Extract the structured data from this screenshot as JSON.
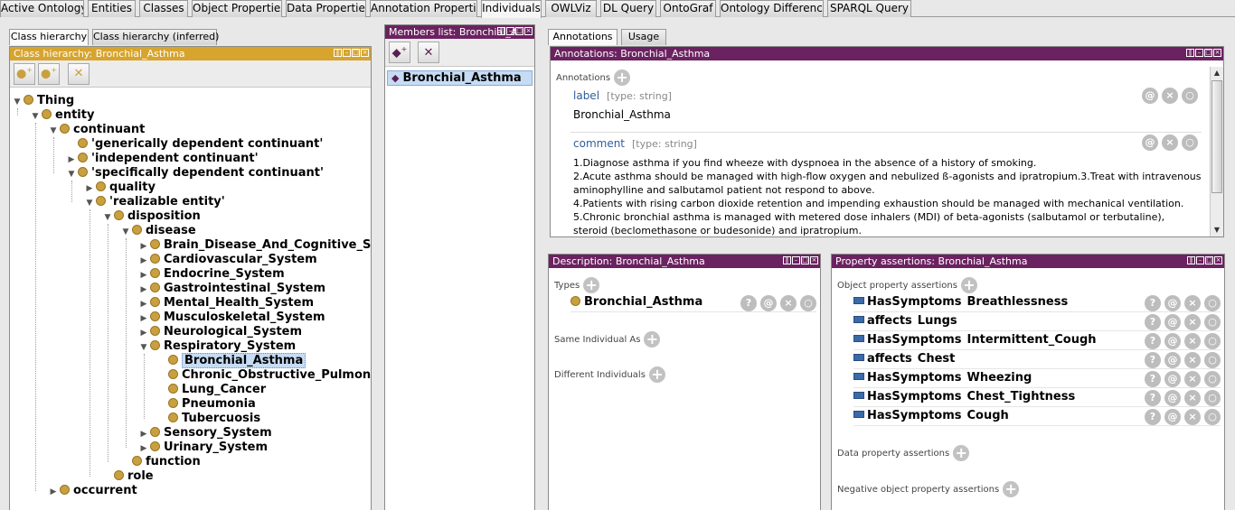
{
  "main_tabs": [
    "Active Ontology",
    "Entities",
    "Classes",
    "Object Properties",
    "Data Properties",
    "Annotation Properties",
    "Individuals",
    "OWLViz",
    "DL Query",
    "OntoGraf",
    "Ontology Differences",
    "SPARQL Query"
  ],
  "selected_main_tab": "Individuals",
  "class_panel": {
    "tabs": [
      "Class hierarchy",
      "Class hierarchy (inferred)"
    ],
    "title": "Class hierarchy: Bronchial_Asthma",
    "tree": [
      {
        "label": "Thing",
        "depth": 0,
        "toggle": "▼"
      },
      {
        "label": "entity",
        "depth": 1,
        "toggle": "▼"
      },
      {
        "label": "continuant",
        "depth": 2,
        "toggle": "▼"
      },
      {
        "label": "'generically dependent continuant'",
        "depth": 3,
        "toggle": ""
      },
      {
        "label": "'independent continuant'",
        "depth": 3,
        "toggle": "▶"
      },
      {
        "label": "'specifically dependent continuant'",
        "depth": 3,
        "toggle": "▼"
      },
      {
        "label": "quality",
        "depth": 4,
        "toggle": "▶"
      },
      {
        "label": "'realizable entity'",
        "depth": 4,
        "toggle": "▼"
      },
      {
        "label": "disposition",
        "depth": 5,
        "toggle": "▼"
      },
      {
        "label": "disease",
        "depth": 6,
        "toggle": "▼"
      },
      {
        "label": "Brain_Disease_And_Cognitive_System",
        "depth": 7,
        "toggle": "▶"
      },
      {
        "label": "Cardiovascular_System",
        "depth": 7,
        "toggle": "▶"
      },
      {
        "label": "Endocrine_System",
        "depth": 7,
        "toggle": "▶"
      },
      {
        "label": "Gastrointestinal_System",
        "depth": 7,
        "toggle": "▶"
      },
      {
        "label": "Mental_Health_System",
        "depth": 7,
        "toggle": "▶"
      },
      {
        "label": "Musculoskeletal_System",
        "depth": 7,
        "toggle": "▶"
      },
      {
        "label": "Neurological_System",
        "depth": 7,
        "toggle": "▶"
      },
      {
        "label": "Respiratory_System",
        "depth": 7,
        "toggle": "▼"
      },
      {
        "label": "Bronchial_Asthma",
        "depth": 8,
        "toggle": "",
        "selected": true
      },
      {
        "label": "Chronic_Obstructive_Pulmonary",
        "depth": 8,
        "toggle": ""
      },
      {
        "label": "Lung_Cancer",
        "depth": 8,
        "toggle": ""
      },
      {
        "label": "Pneumonia",
        "depth": 8,
        "toggle": ""
      },
      {
        "label": "Tubercuosis",
        "depth": 8,
        "toggle": ""
      },
      {
        "label": "Sensory_System",
        "depth": 7,
        "toggle": "▶"
      },
      {
        "label": "Urinary_System",
        "depth": 7,
        "toggle": "▶"
      },
      {
        "label": "function",
        "depth": 6,
        "toggle": ""
      },
      {
        "label": "role",
        "depth": 5,
        "toggle": ""
      },
      {
        "label": "occurrent",
        "depth": 2,
        "toggle": "▶"
      }
    ]
  },
  "members_panel": {
    "title": "Members list: Bronchial_A",
    "items": [
      "Bronchial_Asthma"
    ]
  },
  "annotation_panel": {
    "tabs": [
      "Annotations",
      "Usage"
    ],
    "title": "Annotations: Bronchial_Asthma",
    "section_label": "Annotations",
    "label_name": "label",
    "label_type": "[type: string]",
    "label_value": "Bronchial_Asthma",
    "comment_name": "comment",
    "comment_type": "[type: string]",
    "comment_lines": [
      "1.Diagnose asthma if you find wheeze with dyspnoea in the absence of a history of smoking.",
      "2.Acute asthma should be managed with high-flow oxygen and nebulized ß-agonists and ipratropium.3.Treat with intravenous",
      "aminophylline and salbutamol patient not respond to above.",
      "4.Patients with rising carbon dioxide retention and impending exhaustion should be managed with mechanical ventilation.",
      "5.Chronic bronchial asthma is managed with metered dose inhalers (MDI) of beta-agonists (salbutamol or terbutaline),",
      "steroid (beclomethasone or budesonide) and ipratropium."
    ]
  },
  "description_panel": {
    "title": "Description: Bronchial_Asthma",
    "types_label": "Types",
    "type_value": "Bronchial_Asthma",
    "same_label": "Same Individual As",
    "different_label": "Different Individuals"
  },
  "property_panel": {
    "title": "Property assertions: Bronchial_Asthma",
    "object_label": "Object property assertions",
    "assertions": [
      {
        "property": "HasSymptoms",
        "value": "Breathlessness"
      },
      {
        "property": "affects",
        "value": "Lungs"
      },
      {
        "property": "HasSymptoms",
        "value": "Intermittent_Cough"
      },
      {
        "property": "affects",
        "value": "Chest"
      },
      {
        "property": "HasSymptoms",
        "value": "Wheezing"
      },
      {
        "property": "HasSymptoms",
        "value": "Chest_Tightness"
      },
      {
        "property": "HasSymptoms",
        "value": "Cough"
      }
    ],
    "data_label": "Data property assertions",
    "negative_label": "Negative object property assertions"
  },
  "row_button_glyphs": [
    "?",
    "@",
    "×",
    "○"
  ],
  "colors": {
    "gold_header": "#d7a42d",
    "purple_header": "#6b2260",
    "class_dot": "#c9a040",
    "selection": "#c6dcf4"
  }
}
